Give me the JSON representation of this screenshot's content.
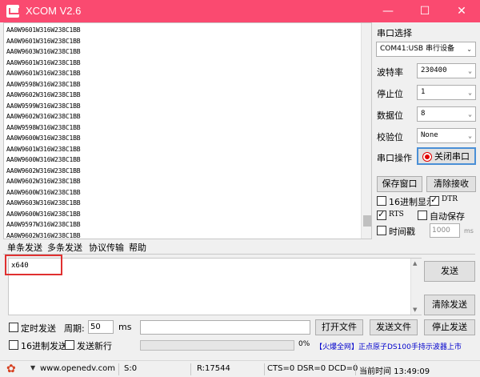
{
  "window": {
    "title": "XCOM V2.6",
    "minimize": "—",
    "maximize": "☐",
    "close": "✕"
  },
  "receive": {
    "lines": [
      "AA0W9601W316W238C1BB",
      "AA0W9601W316W238C1BB",
      "AA0W9603W316W238C1BB",
      "AA0W9601W316W238C1BB",
      "AA0W9601W316W238C1BB",
      "AA0W9598W316W238C1BB",
      "AA0W9602W316W238C1BB",
      "AA0W9599W316W238C1BB",
      "AA0W9602W316W238C1BB",
      "AA0W9598W316W238C1BB",
      "AA0W9600W316W238C1BB",
      "AA0W9601W316W238C1BB",
      "AA0W9600W316W238C1BB",
      "AA0W9602W316W238C1BB",
      "AA0W9602W316W238C1BB",
      "AA0W9600W316W238C1BB",
      "AA0W9603W316W238C1BB",
      "AA0W9600W316W238C1BB",
      "AA0W9597W316W238C1BB",
      "AA0W9602W316W238C1BB"
    ]
  },
  "serial": {
    "section_label": "串口选择",
    "port": "COM41:USB 串行设备",
    "baud_label": "波特率",
    "baud": "230400",
    "stop_label": "停止位",
    "stop": "1",
    "data_label": "数据位",
    "data": "8",
    "parity_label": "校验位",
    "parity": "None",
    "op_label": "串口操作",
    "op_button": "关闭串口",
    "save_window": "保存窗口",
    "clear_recv": "清除接收",
    "hex_display": "16进制显示",
    "dtr": "DTR",
    "rts": "RTS",
    "auto_save": "自动保存",
    "timestamp": "时间戳",
    "timestamp_ms": "1000",
    "ms": "ms"
  },
  "tabs": [
    "单条发送",
    "多条发送",
    "协议传输",
    "帮助"
  ],
  "send": {
    "text": "x640",
    "send_button": "发送",
    "clear_send": "清除发送",
    "timed_send": "定时发送",
    "period_label": "周期:",
    "period": "50",
    "period_unit": "ms",
    "open_file": "打开文件",
    "send_file": "发送文件",
    "stop_send": "停止发送",
    "hex_send": "16进制发送",
    "newline": "发送新行",
    "progress": "0%",
    "ad": "【火爆全网】正点原子DS100手持示波器上市"
  },
  "status": {
    "url": "www.openedv.com",
    "s": "S:0",
    "r": "R:17544",
    "lines": "CTS=0 DSR=0 DCD=0",
    "time": "当前时间 13:49:09"
  },
  "colors": {
    "titlebar": "#fa4a70",
    "highlight": "#e03030",
    "ad": "#0000cc",
    "op_dot": "#e00000"
  }
}
